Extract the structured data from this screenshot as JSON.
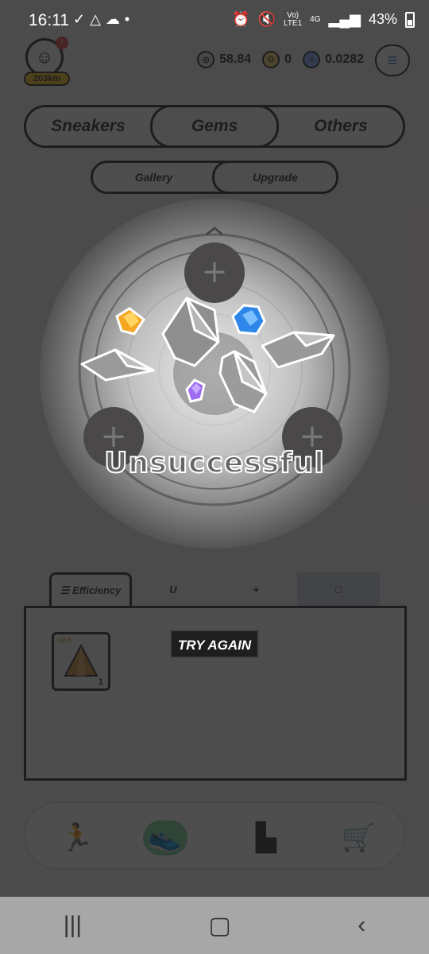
{
  "status_bar": {
    "time": "16:11",
    "network_top": "Vo)",
    "network_bottom": "LTE1",
    "signal_4g": "4G",
    "battery": "43%"
  },
  "header": {
    "notification_badge": "!",
    "distance": "203km",
    "balances": [
      {
        "icon": "gst-coin-icon",
        "value": "58.84"
      },
      {
        "icon": "gmt-coin-icon",
        "value": "0"
      },
      {
        "icon": "solana-coin-icon",
        "value": "0.0282"
      }
    ]
  },
  "category_tabs": [
    {
      "label": "Sneakers",
      "active": false
    },
    {
      "label": "Gems",
      "active": true
    },
    {
      "label": "Others",
      "active": false
    }
  ],
  "sub_tabs": [
    {
      "label": "Gallery",
      "active": false
    },
    {
      "label": "Upgrade",
      "active": true
    }
  ],
  "upgrade": {
    "result": "Unsuccessful",
    "slots": [
      "plus-icon",
      "plus-icon",
      "plus-icon"
    ]
  },
  "attribute_tabs": [
    {
      "label": "Efficiency",
      "icon": "efficiency-icon",
      "active": true
    },
    {
      "label": "",
      "icon": "magnet-icon",
      "active": false
    },
    {
      "label": "",
      "icon": "plus-icon",
      "active": false
    },
    {
      "label": "",
      "icon": "square-icon",
      "active": false
    }
  ],
  "gem_inventory": [
    {
      "bonus": "+2.0",
      "count": "1",
      "icon": "efficiency-gem-icon"
    }
  ],
  "try_again_label": "TRY AGAIN",
  "bottom_nav": [
    "run-icon",
    "sneaker-icon",
    "leaderboard-icon",
    "cart-icon"
  ],
  "colors": {
    "accent_green": "#6fcf97",
    "km_badge": "#f5c518",
    "overlay": "#1e1c1c"
  }
}
